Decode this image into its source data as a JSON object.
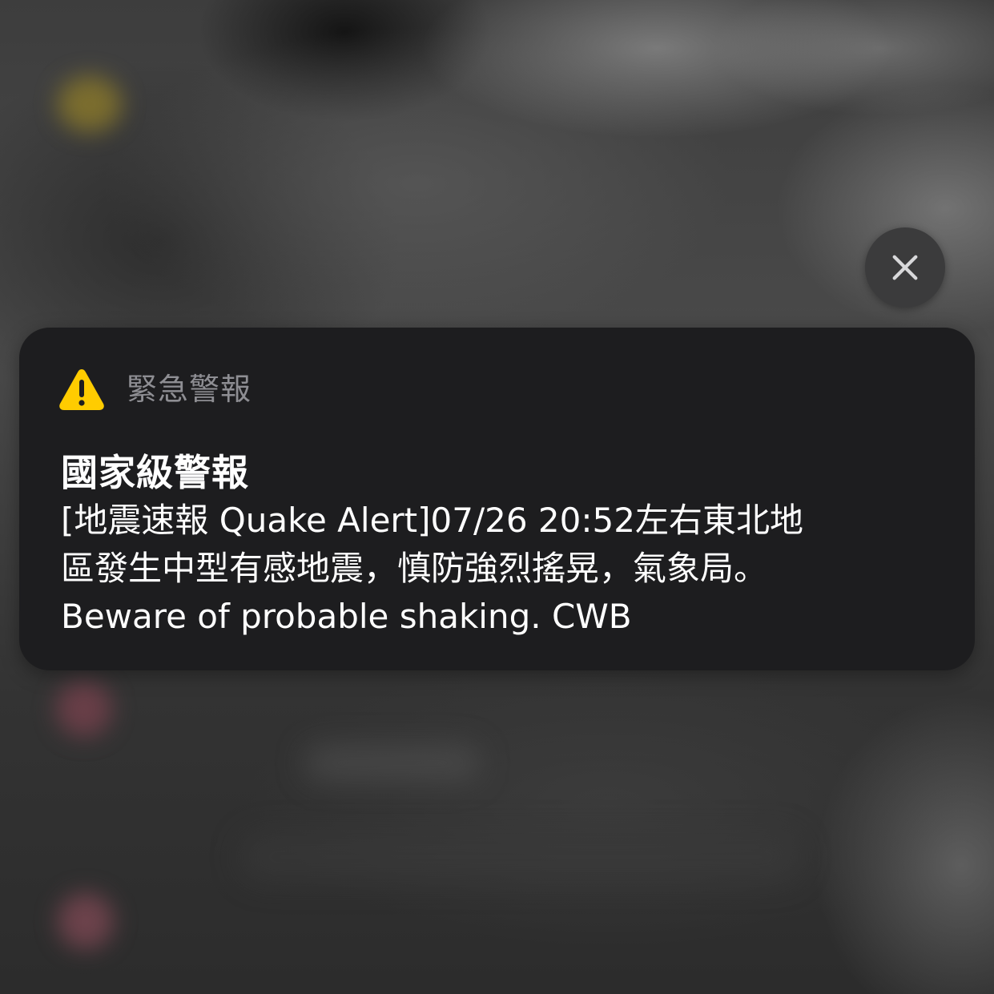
{
  "alert": {
    "category_label": "緊急警報",
    "title": "國家級警報",
    "body_lines": [
      "[地震速報 Quake Alert]07/26 20:52左右東北地",
      "區發生中型有感地震，慎防強烈搖晃，氣象局。",
      "Beware of probable shaking. CWB"
    ],
    "icon": "warning-triangle-icon",
    "icon_color": "#FFCC00",
    "card_color": "#1D1D1F"
  },
  "close_button": {
    "icon": "close-x-icon",
    "color": "#3B3B3C"
  }
}
